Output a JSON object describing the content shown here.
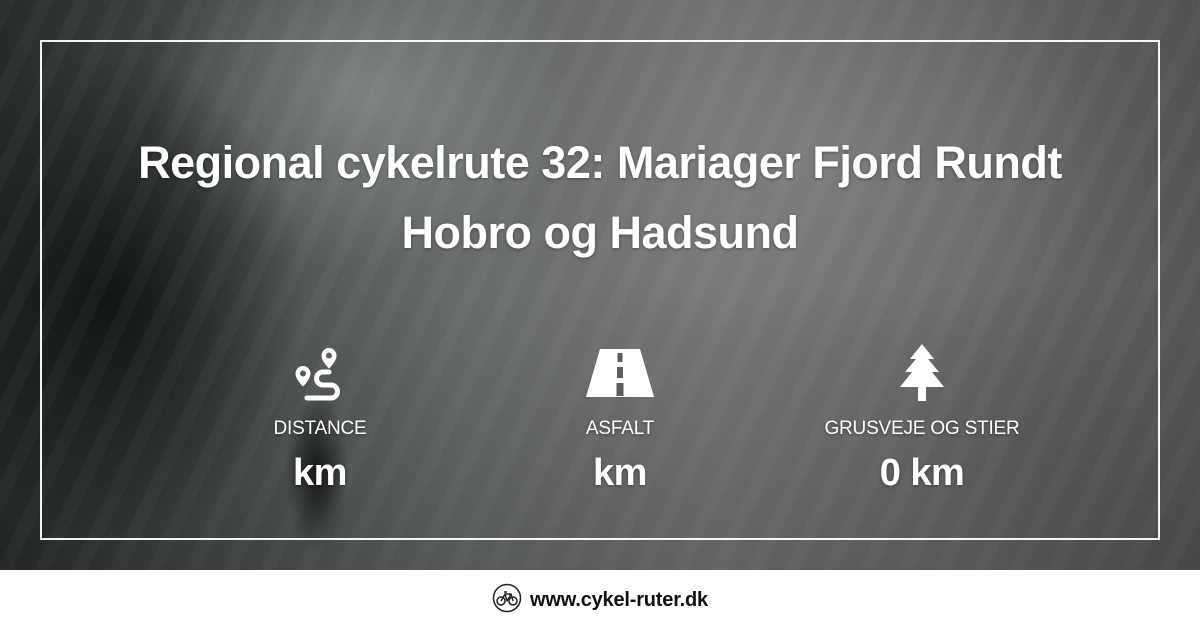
{
  "title": {
    "line1": "Regional cykelrute 32: Mariager Fjord Rundt",
    "line2": "Hobro og Hadsund"
  },
  "stats": [
    {
      "label": "DISTANCE",
      "value": "km",
      "icon": "route-pin-icon"
    },
    {
      "label": "ASFALT",
      "value": "km",
      "icon": "road-icon"
    },
    {
      "label": "GRUSVEJE OG STIER",
      "value": "0 km",
      "icon": "pine-tree-icon"
    }
  ],
  "footer": {
    "site": "www.cykel-ruter.dk",
    "icon": "bicycle-icon"
  },
  "colors": {
    "text": "#ffffff",
    "frame": "#ffffff",
    "footer_bg": "#ffffff",
    "footer_text": "#111111"
  }
}
